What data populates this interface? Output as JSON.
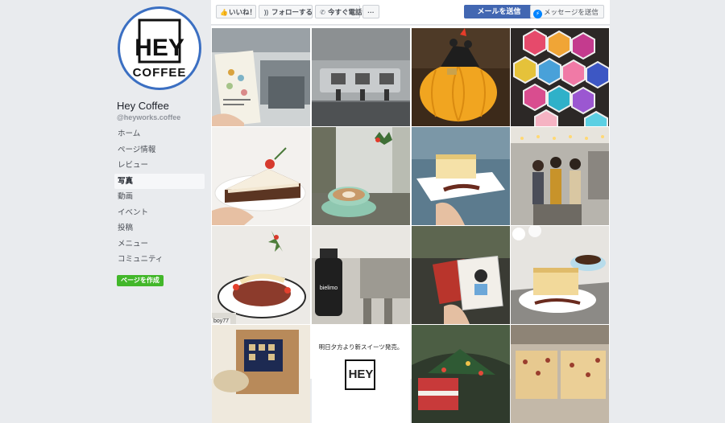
{
  "page": {
    "name": "Hey Coffee",
    "handle": "@heyworks.coffee",
    "logo_text": [
      "HEY",
      "COFFEE"
    ]
  },
  "actions": {
    "like": "いいね！",
    "follow": "フォローする",
    "call": "今すぐ電話",
    "more": "···",
    "mail": "メールを送信",
    "message": "メッセージを送信"
  },
  "nav": {
    "items": [
      "ホーム",
      "ページ情報",
      "レビュー",
      "写真",
      "動画",
      "イベント",
      "投稿",
      "メニュー",
      "コミュニティ"
    ],
    "active": "写真"
  },
  "create_page": "ページを作成",
  "photos": {
    "captions": {
      "cafe_menu": "boy77",
      "announcement": "明日夕方より新スイーツ発売。",
      "logo": "HEY",
      "bottle": "bielimo"
    }
  },
  "colors": {
    "page_bg": "#e9ebee",
    "primary_button": "#4267b2",
    "create_button": "#42b72a",
    "avatar_ring": "#3b6fc2"
  }
}
